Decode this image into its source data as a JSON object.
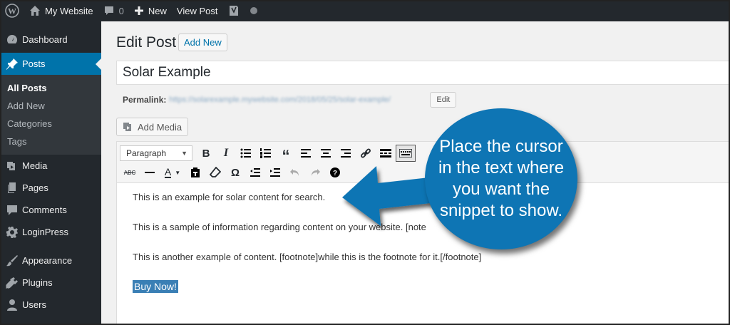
{
  "adminbar": {
    "site_name": "My Website",
    "comments_count": "0",
    "new_label": "New",
    "view_post_label": "View Post"
  },
  "sidebar": {
    "items": [
      {
        "label": "Dashboard",
        "icon": "dashboard-icon"
      },
      {
        "label": "Posts",
        "icon": "pin-icon",
        "current": true
      },
      {
        "label": "Media",
        "icon": "media-icon"
      },
      {
        "label": "Pages",
        "icon": "pages-icon"
      },
      {
        "label": "Comments",
        "icon": "comment-icon"
      },
      {
        "label": "LoginPress",
        "icon": "gear-icon"
      },
      {
        "label": "Appearance",
        "icon": "brush-icon"
      },
      {
        "label": "Plugins",
        "icon": "plugin-icon"
      },
      {
        "label": "Users",
        "icon": "user-icon"
      }
    ],
    "submenu": [
      "All Posts",
      "Add New",
      "Categories",
      "Tags"
    ]
  },
  "main": {
    "page_title": "Edit Post",
    "add_new_label": "Add New",
    "post_title": "Solar Example",
    "permalink_label": "Permalink:",
    "permalink_url": "https://solarexample.mywebsite.com/2018/05/25/solar-example/",
    "permalink_edit": "Edit",
    "add_media_label": "Add Media"
  },
  "editor": {
    "format": "Paragraph",
    "paragraphs": [
      "This is an example for solar content for search.",
      "This is a sample of information regarding content on your website. [note",
      "This is another example of content. [footnote]while this is the footnote for it.[/footnote]"
    ],
    "button_text": "Buy Now!"
  },
  "callout": {
    "text": "Place the cursor in the text where you want the snippet to show.",
    "color": "#0e75b4"
  },
  "colors": {
    "adminbar_bg": "#23282d",
    "accent": "#0073aa"
  }
}
